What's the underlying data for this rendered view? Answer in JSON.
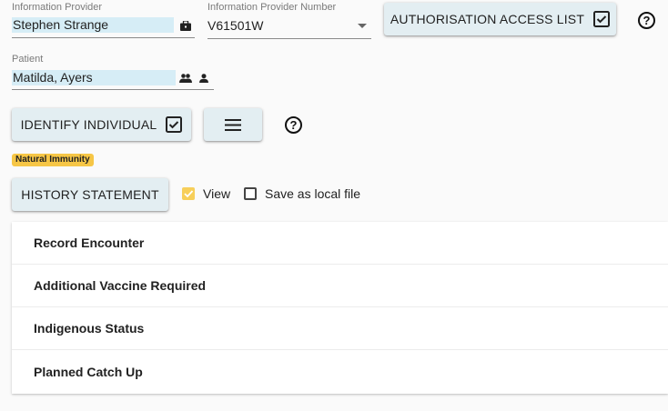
{
  "information_provider": {
    "label": "Information Provider",
    "value": "Stephen Strange",
    "icon": "briefcase-icon"
  },
  "provider_number": {
    "label": "Information Provider Number",
    "value": "V61501W",
    "icon": "dropdown-arrow-icon"
  },
  "authorisation_button": {
    "label": "Authorisation Access List",
    "icon": "checkbox-icon"
  },
  "patient": {
    "label": "Patient",
    "value": "Matilda, Ayers",
    "icons": [
      "people-icon",
      "person-icon"
    ]
  },
  "identify_button": {
    "label": "Identify Individual",
    "icon": "checkbox-icon"
  },
  "menu_button": {
    "icon": "hamburger-menu-icon"
  },
  "help_glyph": "?",
  "natural_immunity_badge": {
    "label": "Natural Immunity",
    "color": "#f6c646"
  },
  "history_button": {
    "label": "History Statement"
  },
  "view_checkbox": {
    "label": "View",
    "checked": true,
    "color": "#f7cf5a"
  },
  "save_checkbox": {
    "label": "Save as local file",
    "checked": false
  },
  "panels": [
    {
      "label": "Record Encounter"
    },
    {
      "label": "Additional Vaccine Required"
    },
    {
      "label": "Indigenous Status"
    },
    {
      "label": "Planned Catch Up"
    }
  ],
  "colors": {
    "background": "#fafafa",
    "button_bg": "#e3eef2",
    "field_highlight": "#d6edf6"
  }
}
